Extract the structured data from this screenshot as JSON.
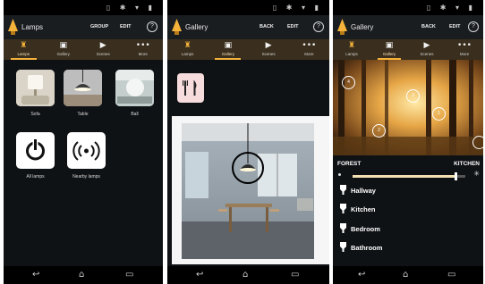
{
  "status_icons": "▯ ✱ ▾ ▮",
  "nav_icons": {
    "back": "↩",
    "home": "⌂",
    "recent": "▭"
  },
  "accent_color": "#f4b23a",
  "panel1": {
    "title": "Lamps",
    "actions": [
      "GROUP",
      "EDIT"
    ],
    "help": "?",
    "tabs": [
      {
        "icon": "♜",
        "label": "Lamps"
      },
      {
        "icon": "▣",
        "label": "Gallery"
      },
      {
        "icon": "▶",
        "label": "Scenes"
      },
      {
        "icon": "•••",
        "label": "More"
      }
    ],
    "lamps": [
      {
        "label": "Sofa",
        "icon": "sofa-lamp-thumbnail"
      },
      {
        "label": "Table",
        "icon": "table-lamp-thumbnail"
      },
      {
        "label": "Ball",
        "icon": "ball-lamp-thumbnail"
      },
      {
        "label": "All lamps",
        "icon": "power-icon"
      },
      {
        "label": "Nearby lamps",
        "icon": "nearby-signal-icon"
      }
    ]
  },
  "panel2": {
    "title": "Gallery",
    "actions": [
      "BACK",
      "EDIT"
    ],
    "help": "?",
    "tabs": [
      {
        "icon": "♜",
        "label": "Lamps"
      },
      {
        "icon": "▣",
        "label": "Gallery"
      },
      {
        "icon": "▶",
        "label": "Scenes"
      },
      {
        "icon": "•••",
        "label": "More"
      }
    ],
    "category_icon": "fork-knife-icon"
  },
  "panel3": {
    "title": "Gallery",
    "actions": [
      "BACK",
      "EDIT"
    ],
    "help": "?",
    "tabs": [
      {
        "icon": "♜",
        "label": "Lamps"
      },
      {
        "icon": "▣",
        "label": "Gallery"
      },
      {
        "icon": "▶",
        "label": "Scenes"
      },
      {
        "icon": "•••",
        "label": "More"
      }
    ],
    "markers": [
      "4",
      "3",
      "1",
      "2",
      ""
    ],
    "scene_left": "FOREST",
    "scene_right": "KITCHEN",
    "brightness": 0.92,
    "rooms": [
      "Hallway",
      "Kitchen",
      "Bedroom",
      "Bathroom"
    ]
  }
}
